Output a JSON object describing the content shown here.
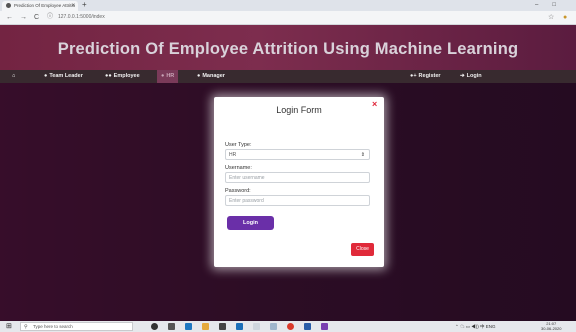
{
  "browser": {
    "tab_title": "Prediction Of Employee Attritio",
    "tab_close": "×",
    "new_tab": "+",
    "back": "←",
    "forward": "→",
    "reload": "C",
    "url": "127.0.0.1:5000/index",
    "minimize": "–",
    "restore": "□"
  },
  "page": {
    "title": "Prediction Of Employee Attrition Using Machine Learning",
    "nav": {
      "home_icon": "home-icon",
      "team_leader": "Team Leader",
      "employee": "Employee",
      "hr": "HR",
      "manager": "Manager",
      "register": "Register",
      "login": "Login"
    }
  },
  "modal": {
    "title": "Login Form",
    "close_x": "×",
    "user_type_label": "User Type:",
    "user_type_value": "HR",
    "username_label": "Username:",
    "username_placeholder": "Enter username",
    "password_label": "Password:",
    "password_placeholder": "Enter password",
    "login_button": "Login",
    "close_button": "Close"
  },
  "taskbar": {
    "search_placeholder": "Type here to search",
    "tray_text": "ENG",
    "time": "21:07",
    "date": "30-06-2020"
  },
  "colors": {
    "header": "#7d2d4e",
    "navbar": "#382a2f",
    "login_button": "#6a2fa8",
    "close_button": "#e02a3a",
    "close_x": "#e0263a"
  }
}
